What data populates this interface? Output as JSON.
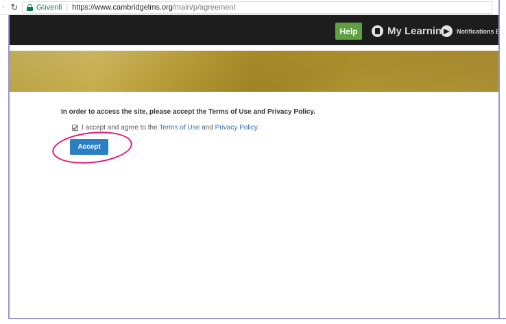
{
  "browser": {
    "secure_label": "Güvenli",
    "url_host": "https://www.cambridgelms.org",
    "url_path": "/main/p/agreement"
  },
  "navbar": {
    "help_label": "Help",
    "my_learning_label": "My Learning",
    "notifications_label": "Notifications",
    "overflow_label": "E"
  },
  "content": {
    "heading": "In order to access the site, please accept the Terms of Use and Privacy Policy.",
    "agree_prefix": "I accept and agree to the ",
    "terms_link": "Terms of Use",
    "agree_and": " and ",
    "privacy_link": "Privacy Policy",
    "agree_suffix": ".",
    "checkbox_checked": true,
    "accept_label": "Accept"
  },
  "colors": {
    "navbar_bg": "#1d1d1d",
    "help_green": "#5fa043",
    "accept_blue": "#2b80c4",
    "banner_gold": "#b39a34",
    "highlight_pink": "#e6147b",
    "link_blue": "#2a6fb6"
  },
  "icons": {
    "reload": "reload-icon",
    "lock": "lock-icon",
    "my_learning": "book-icon",
    "notifications": "megaphone-icon"
  }
}
